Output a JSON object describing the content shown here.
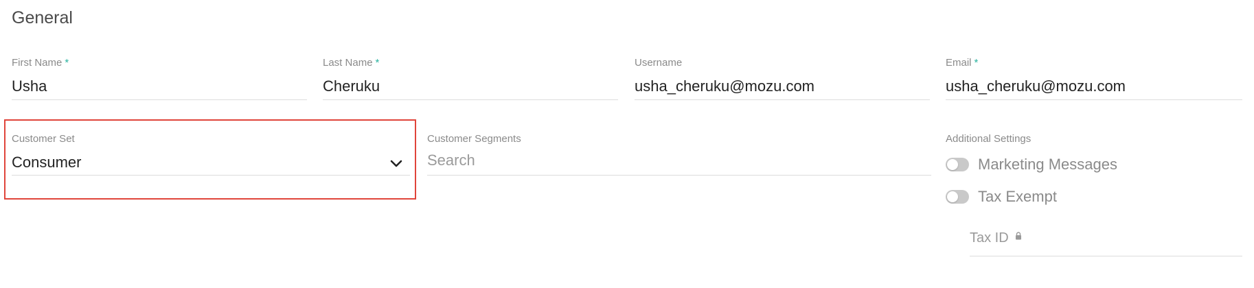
{
  "section": {
    "title": "General"
  },
  "fields": {
    "first_name": {
      "label": "First Name",
      "required_mark": "*",
      "value": "Usha"
    },
    "last_name": {
      "label": "Last Name",
      "required_mark": "*",
      "value": "Cheruku"
    },
    "username": {
      "label": "Username",
      "value": "usha_cheruku@mozu.com"
    },
    "email": {
      "label": "Email",
      "required_mark": "*",
      "value": "usha_cheruku@mozu.com"
    },
    "customer_set": {
      "label": "Customer Set",
      "value": "Consumer",
      "icon": "chevron-down-icon"
    },
    "customer_segments": {
      "label": "Customer Segments",
      "placeholder": "Search"
    },
    "additional_settings": {
      "label": "Additional Settings",
      "toggles": [
        {
          "label": "Marketing Messages",
          "state": "off"
        },
        {
          "label": "Tax Exempt",
          "state": "off"
        }
      ]
    },
    "tax_id": {
      "label": "Tax ID",
      "icon": "lock-icon"
    }
  },
  "colors": {
    "required_accent": "#2bb3a0",
    "highlight_border": "#e0443a",
    "toggle_off": "#c9c9c9"
  }
}
